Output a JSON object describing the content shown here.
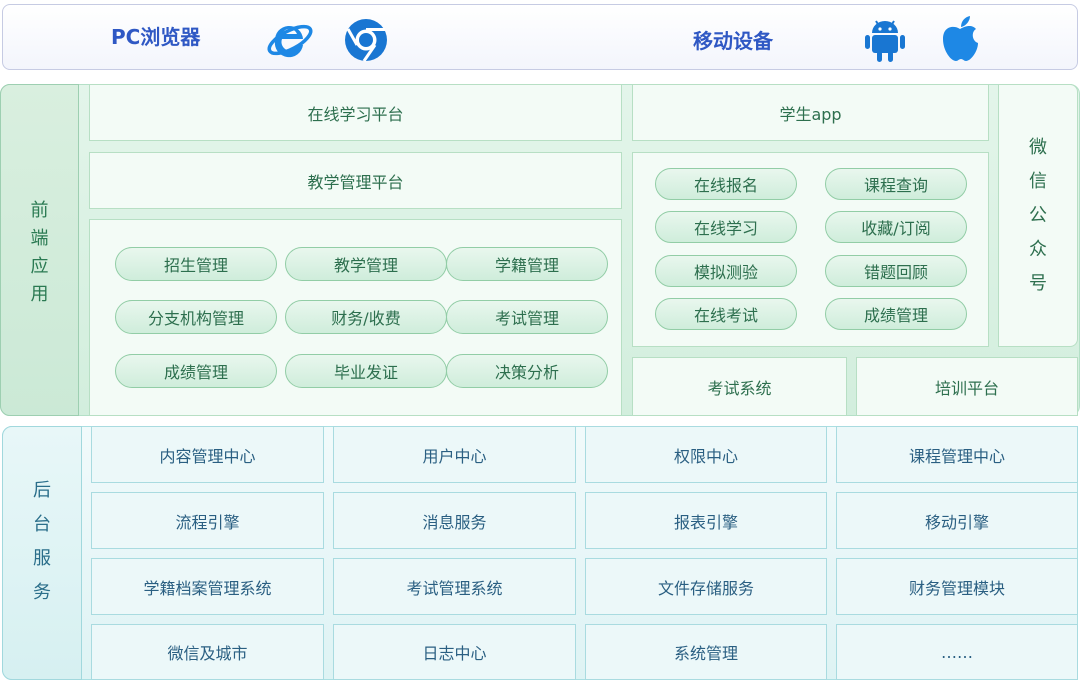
{
  "top": {
    "pc_label": "PC浏览器",
    "mobile_label": "移动设备",
    "colors": {
      "ie": "#1e88e5",
      "chrome": "#1976d2",
      "android": "#1976d2",
      "apple": "#1e88e5"
    }
  },
  "front": {
    "label_chars": [
      "前",
      "端",
      "应",
      "用"
    ],
    "online_platform": "在线学习平台",
    "teaching_platform": "教学管理平台",
    "modules": [
      "招生管理",
      "教学管理",
      "学籍管理",
      "分支机构管理",
      "财务/收费",
      "考试管理",
      "成绩管理",
      "毕业发证",
      "决策分析"
    ],
    "student_app": "学生app",
    "app_features": [
      "在线报名",
      "课程查询",
      "在线学习",
      "收藏/订阅",
      "模拟测验",
      "错题回顾",
      "在线考试",
      "成绩管理"
    ],
    "wechat_chars": [
      "微",
      "信",
      "公",
      "众",
      "号"
    ],
    "exam_system": "考试系统",
    "training_platform": "培训平台"
  },
  "back": {
    "label_chars": [
      "后",
      "台",
      "服",
      "务"
    ],
    "services": [
      "内容管理中心",
      "用户中心",
      "权限中心",
      "课程管理中心",
      "流程引擎",
      "消息服务",
      "报表引擎",
      "移动引擎",
      "学籍档案管理系统",
      "考试管理系统",
      "文件存储服务",
      "财务管理模块",
      "微信及城市",
      "日志中心",
      "系统管理",
      "……"
    ]
  }
}
